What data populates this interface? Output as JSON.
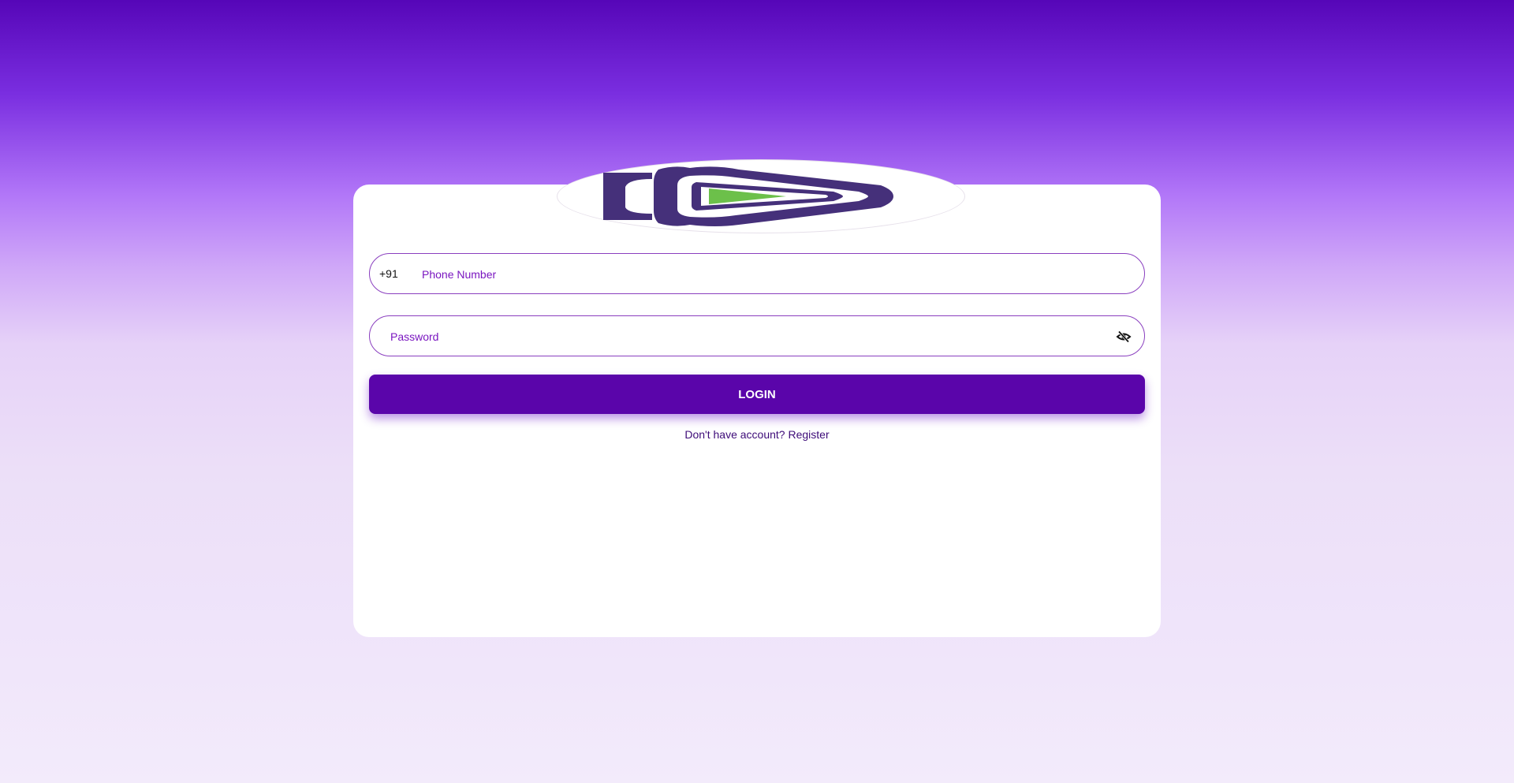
{
  "colors": {
    "accent": "#5a05aa",
    "field_border": "#8a3fbf",
    "placeholder_text": "#7a16c0",
    "logo_purple": "#45307a",
    "logo_green": "#6cc04a",
    "link_text": "#3d0b78"
  },
  "logo": {
    "icon": "brand-logo"
  },
  "form": {
    "phone": {
      "country_code": "+91",
      "placeholder": "Phone Number",
      "value": ""
    },
    "password": {
      "placeholder": "Password",
      "value": "",
      "toggle_icon": "eye-slash-icon"
    },
    "login_label": "LOGIN",
    "register_prompt": "Don't have account?",
    "register_link": "Register"
  }
}
